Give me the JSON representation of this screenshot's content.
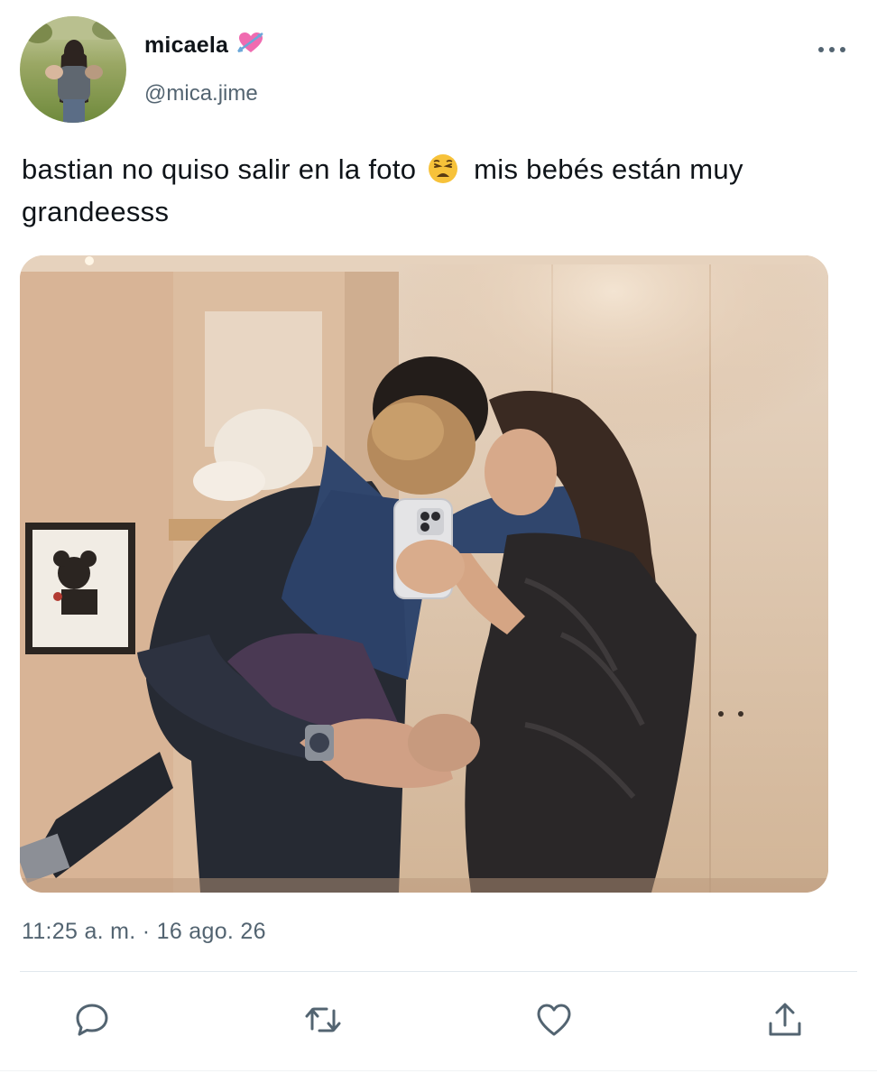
{
  "user": {
    "display_name": "micaela",
    "name_emoji": "heart-with-arrow-icon",
    "handle": "@mica.jime"
  },
  "tweet": {
    "text_part1": "bastian no quiso salir en la foto",
    "emoji": "weary-face-icon",
    "text_part2": "mis bebés están muy grandeesss",
    "timestamp": "11:25 a. m. · 16 ago. 26"
  },
  "actions": [
    "reply-icon",
    "retweet-icon",
    "like-icon",
    "share-icon"
  ],
  "colors": {
    "text": "#0f1419",
    "secondary": "#536471",
    "icon": "#536471",
    "divider": "#e1e8ed"
  }
}
